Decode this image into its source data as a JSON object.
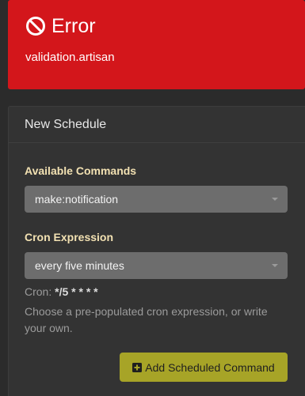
{
  "error": {
    "title": "Error",
    "message": "validation.artisan"
  },
  "schedule": {
    "title": "New Schedule",
    "commands": {
      "label": "Available Commands",
      "selected": "make:notification"
    },
    "cron": {
      "label": "Cron Expression",
      "selected": "every five minutes",
      "prefix": "Cron:",
      "value": "*/5 * * * *",
      "help": "Choose a pre-populated cron expression, or write your own."
    },
    "add_button_label": "Add Scheduled Command"
  },
  "colors": {
    "error_bg": "#d3161b",
    "button_bg": "#a7a427",
    "label_color": "#f2e1b2"
  },
  "icons": {
    "error": "ban-icon",
    "add": "plus-square-icon",
    "dropdown": "caret-down-icon"
  }
}
